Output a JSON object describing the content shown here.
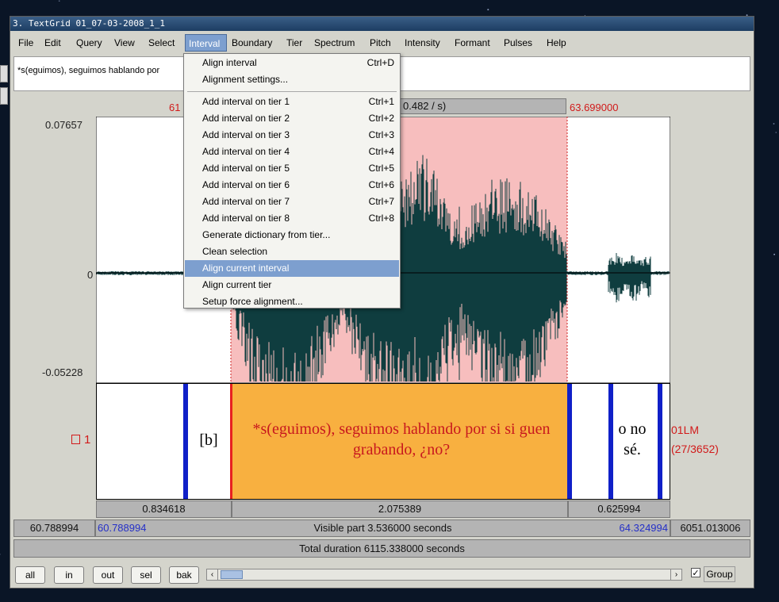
{
  "window": {
    "title": "3. TextGrid 01_07-03-2008_1_1"
  },
  "menubar": {
    "items": [
      "File",
      "Edit",
      "Query",
      "View",
      "Select",
      "Interval",
      "Boundary",
      "Tier",
      "Spectrum",
      "Pitch",
      "Intensity",
      "Formant",
      "Pulses",
      "Help"
    ],
    "active": "Interval"
  },
  "infobox": {
    "text": "*s(eguimos), seguimos hablando por"
  },
  "header": {
    "left_time": "61",
    "center_partial": "0.482 / s)",
    "right_time": "63.699000"
  },
  "waveform": {
    "ymax": "0.07657",
    "zero": "0",
    "ymin": "-0.05228"
  },
  "tier": {
    "number": "1",
    "name": "01LM",
    "count": "(27/3652)",
    "intervals": [
      "[b]",
      "*s(eguimos), seguimos hablando por si si guen grabando, ¿no?",
      "o no sé."
    ]
  },
  "durations": {
    "left": "0.834618",
    "center": "2.075389",
    "right": "0.625994"
  },
  "visible": {
    "outer_left": "60.788994",
    "left": "60.788994",
    "label": "Visible part 3.536000 seconds",
    "right": "64.324994",
    "outer_right": "6051.013006"
  },
  "total": {
    "label": "Total duration 6115.338000 seconds"
  },
  "buttons": {
    "all": "all",
    "in": "in",
    "out": "out",
    "sel": "sel",
    "bak": "bak",
    "group": "Group"
  },
  "dropdown": {
    "items": [
      {
        "label": "Align interval",
        "shortcut": "Ctrl+D"
      },
      {
        "label": "Alignment settings...",
        "shortcut": ""
      },
      {
        "label": "Add interval on tier 1",
        "shortcut": "Ctrl+1"
      },
      {
        "label": "Add interval on tier 2",
        "shortcut": "Ctrl+2"
      },
      {
        "label": "Add interval on tier 3",
        "shortcut": "Ctrl+3"
      },
      {
        "label": "Add interval on tier 4",
        "shortcut": "Ctrl+4"
      },
      {
        "label": "Add interval on tier 5",
        "shortcut": "Ctrl+5"
      },
      {
        "label": "Add interval on tier 6",
        "shortcut": "Ctrl+6"
      },
      {
        "label": "Add interval on tier 7",
        "shortcut": "Ctrl+7"
      },
      {
        "label": "Add interval on tier 8",
        "shortcut": "Ctrl+8"
      },
      {
        "label": "Generate dictionary from tier...",
        "shortcut": ""
      },
      {
        "label": "Clean selection",
        "shortcut": ""
      },
      {
        "label": "Align current interval",
        "shortcut": ""
      },
      {
        "label": "Align current tier",
        "shortcut": ""
      },
      {
        "label": "Setup force alignment...",
        "shortcut": ""
      }
    ],
    "highlighted": "Align current interval"
  },
  "colors": {
    "selection": "#f7bebe",
    "interval_fill": "#f8b040",
    "wave": "#0f3d3f",
    "boundary": "#1020c8",
    "time_red": "#d11a1a",
    "time_blue": "#2530c8"
  }
}
